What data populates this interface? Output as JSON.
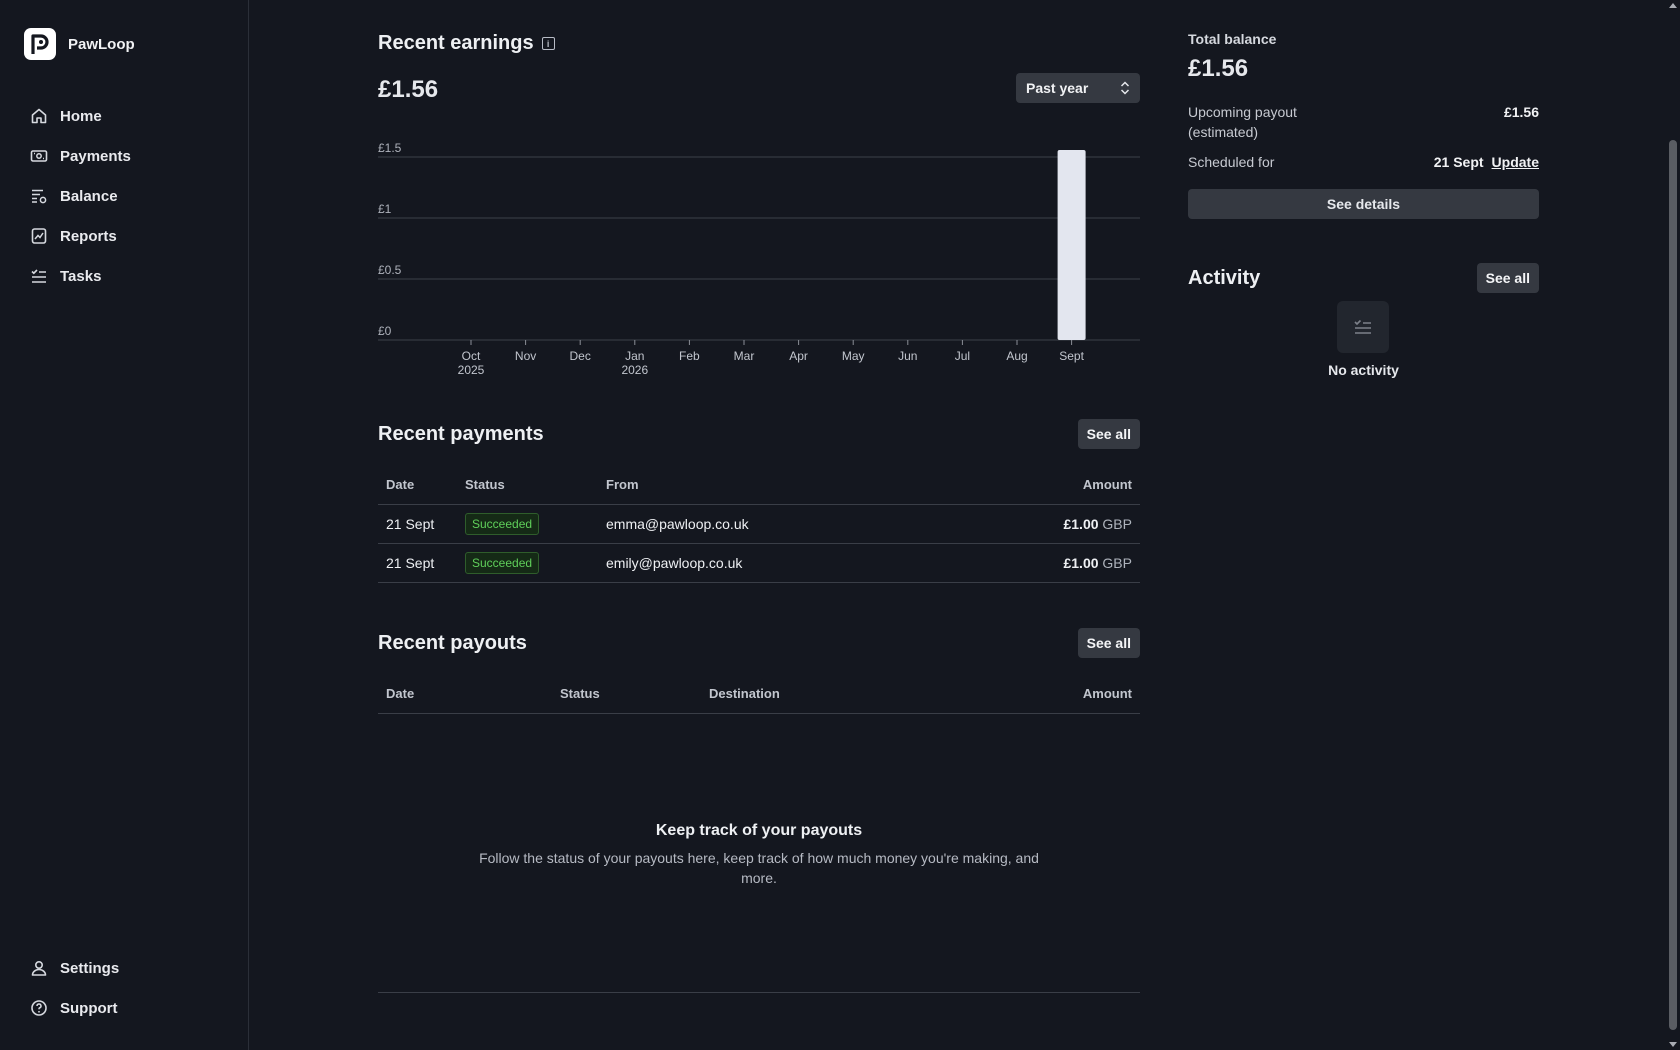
{
  "brand": {
    "name": "PawLoop"
  },
  "nav": {
    "items": [
      {
        "label": "Home",
        "icon": "home-icon"
      },
      {
        "label": "Payments",
        "icon": "banknote-icon"
      },
      {
        "label": "Balance",
        "icon": "balance-icon"
      },
      {
        "label": "Reports",
        "icon": "reports-icon"
      },
      {
        "label": "Tasks",
        "icon": "tasks-icon"
      }
    ],
    "bottom": [
      {
        "label": "Settings",
        "icon": "user-icon"
      },
      {
        "label": "Support",
        "icon": "help-icon"
      }
    ]
  },
  "earnings": {
    "title": "Recent earnings",
    "total": "£1.56",
    "range": "Past year"
  },
  "chart_data": {
    "type": "bar",
    "categories": [
      "Oct",
      "Nov",
      "Dec",
      "Jan",
      "Feb",
      "Mar",
      "Apr",
      "May",
      "Jun",
      "Jul",
      "Aug",
      "Sept"
    ],
    "category_sublabels": [
      "2025",
      "",
      "",
      "2026",
      "",
      "",
      "",
      "",
      "",
      "",
      "",
      ""
    ],
    "values": [
      0,
      0,
      0,
      0,
      0,
      0,
      0,
      0,
      0,
      0,
      0,
      1.56
    ],
    "yticks": [
      "£0",
      "£0.5",
      "£1",
      "£1.5"
    ],
    "ytick_values": [
      0,
      0.5,
      1,
      1.5
    ],
    "ylim": [
      0,
      1.5
    ],
    "grid": true,
    "bar_color": "#e3e6ef"
  },
  "payments": {
    "title": "Recent payments",
    "see_all": "See all",
    "columns": [
      "Date",
      "Status",
      "From",
      "Amount"
    ],
    "rows": [
      {
        "date": "21 Sept",
        "status": "Succeeded",
        "from": "emma@pawloop.co.uk",
        "amount": "£1.00",
        "currency": "GBP"
      },
      {
        "date": "21 Sept",
        "status": "Succeeded",
        "from": "emily@pawloop.co.uk",
        "amount": "£1.00",
        "currency": "GBP"
      }
    ]
  },
  "payouts": {
    "title": "Recent payouts",
    "see_all": "See all",
    "columns": [
      "Date",
      "Status",
      "Destination",
      "Amount"
    ],
    "empty_title": "Keep track of your payouts",
    "empty_desc": "Follow the status of your payouts here, keep track of how much money you're making, and more."
  },
  "balance": {
    "label": "Total balance",
    "value": "£1.56",
    "upcoming_label": "Upcoming payout",
    "upcoming_sub": "(estimated)",
    "upcoming_value": "£1.56",
    "scheduled_label": "Scheduled for",
    "scheduled_value": "21 Sept",
    "update_link": "Update",
    "details_button": "See details"
  },
  "activity": {
    "title": "Activity",
    "see_all": "See all",
    "empty": "No activity"
  },
  "colors": {
    "background": "#14171f",
    "success": "#5fcf5a",
    "button": "#353941"
  }
}
